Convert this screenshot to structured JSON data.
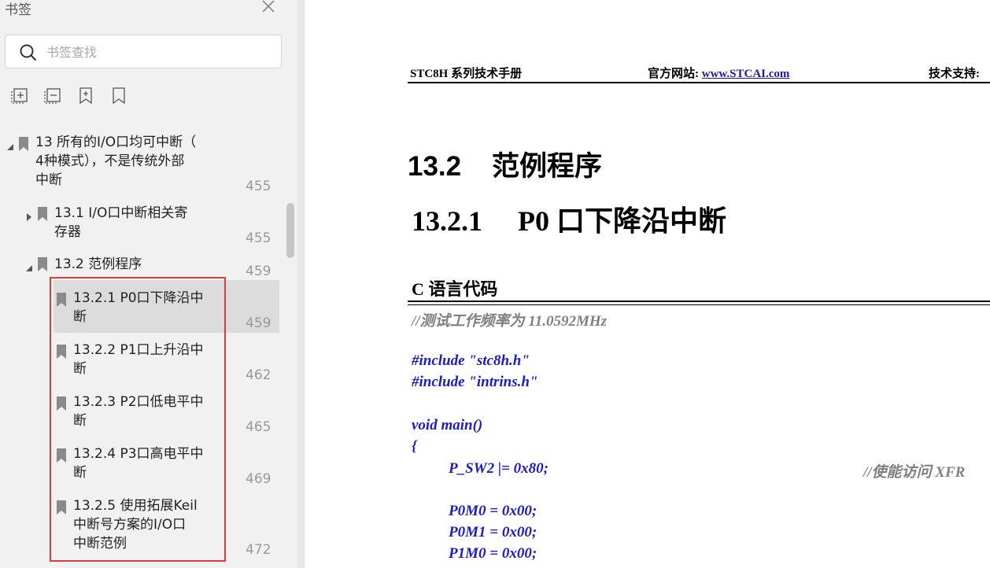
{
  "sidebar": {
    "title": "书签",
    "search_placeholder": "书签查找",
    "toolbar": [
      "expand-all-icon",
      "collapse-all-icon",
      "add-bookmark-icon",
      "bookmark-icon"
    ],
    "items": [
      {
        "label_lines": [
          "13 所有的I/O口均可中断（",
          "4种模式），不是传统外部",
          "中断"
        ],
        "page": "455"
      },
      {
        "label_lines": [
          "13.1 I/O口中断相关寄",
          "存器"
        ],
        "page": "455"
      },
      {
        "label_lines": [
          "13.2 范例程序"
        ],
        "page": "459"
      },
      {
        "label_lines": [
          "13.2.1 P0口下降沿中",
          "断"
        ],
        "page": "459"
      },
      {
        "label_lines": [
          "13.2.2 P1口上升沿中",
          "断"
        ],
        "page": "462"
      },
      {
        "label_lines": [
          "13.2.3 P2口低电平中",
          "断"
        ],
        "page": "465"
      },
      {
        "label_lines": [
          "13.2.4 P3口高电平中",
          "断"
        ],
        "page": "469"
      },
      {
        "label_lines": [
          "13.2.5 使用拓展Keil",
          "中断号方案的I/O口",
          "中断范例"
        ],
        "page": "472"
      }
    ]
  },
  "document": {
    "header_left": "STC8H 系列技术手册",
    "header_mid_label": "官方网站: ",
    "header_mid_link": "www.STCAI.com",
    "header_right": "技术支持:",
    "section_title": "13.2    范例程序",
    "subsection_title": "13.2.1     P0 口下降沿中断",
    "code_heading": "C 语言代码",
    "code_lines": [
      "//测试工作频率为 11.0592MHz",
      "#include \"stc8h.h\"",
      "#include \"intrins.h\"",
      "void main()",
      "{",
      "P_SW2 |= 0x80;",
      "//使能访问 XFR",
      "P0M0 = 0x00;",
      "P0M1 = 0x00;",
      "P1M0 = 0x00;"
    ]
  },
  "colors": {
    "sidebar_bg": "#f1f1f1",
    "selected_bg": "#dcdcdc",
    "highlight_border": "#e03c3c",
    "code_blue": "#1a1ad0",
    "link_blue": "#1a1aa6"
  }
}
